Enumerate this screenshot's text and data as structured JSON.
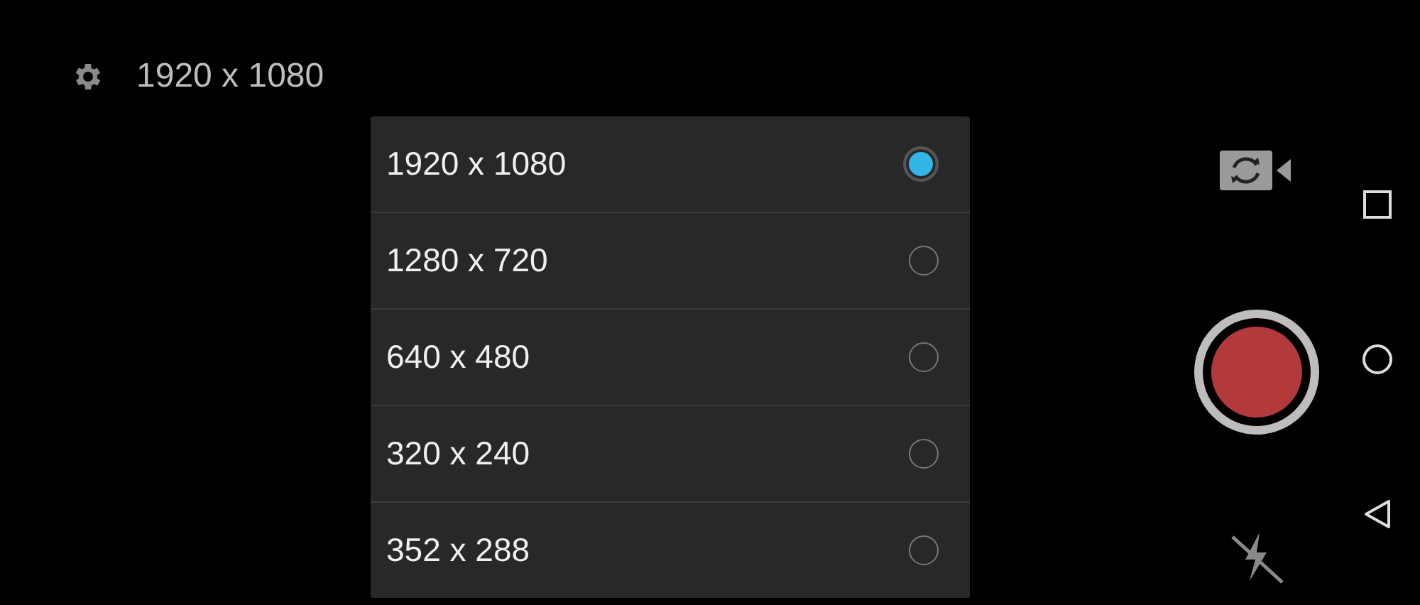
{
  "settings_label": "1920 x 1080",
  "resolution_options": [
    {
      "label": "1920 x 1080",
      "selected": true
    },
    {
      "label": "1280 x 720",
      "selected": false
    },
    {
      "label": "640 x 480",
      "selected": false
    },
    {
      "label": "320 x 240",
      "selected": false
    },
    {
      "label": "352 x 288",
      "selected": false
    }
  ]
}
